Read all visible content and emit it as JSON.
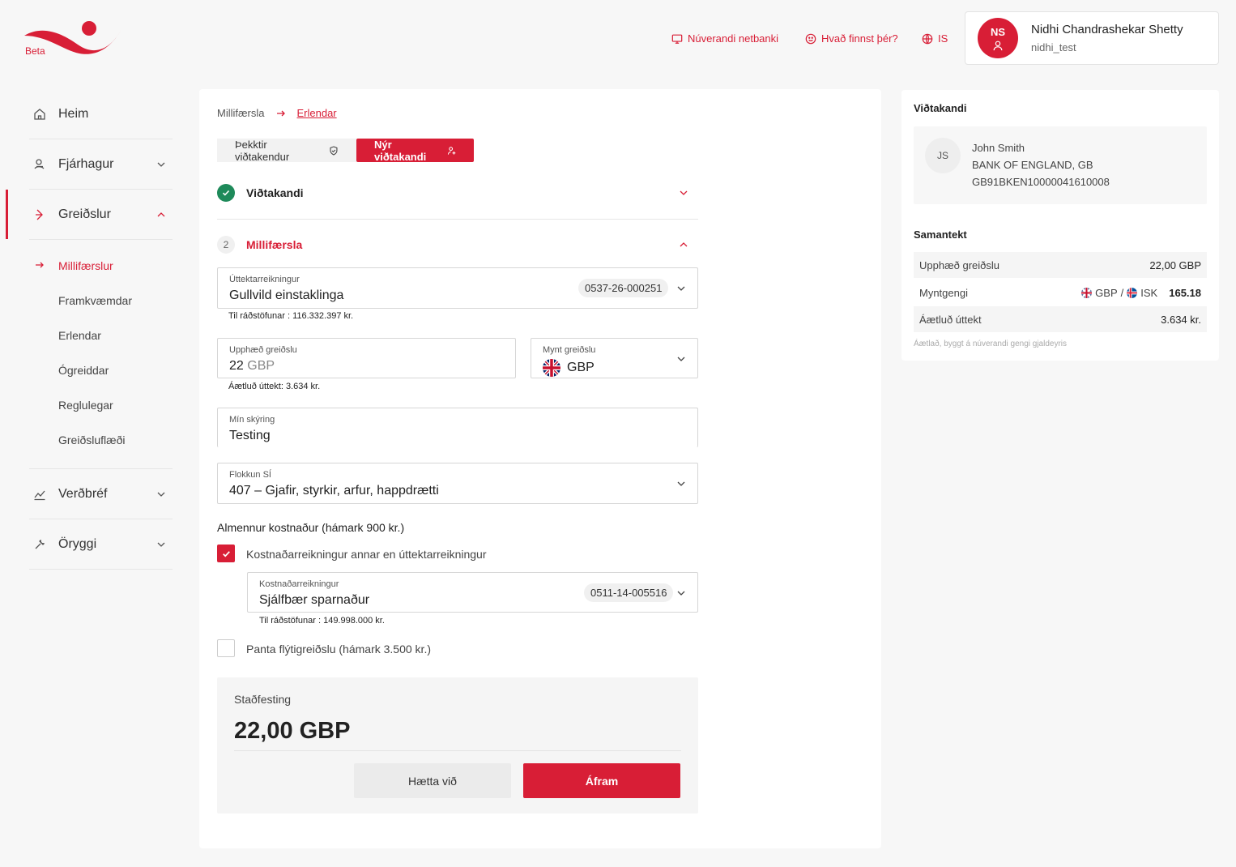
{
  "header": {
    "beta_label": "Beta",
    "links": [
      {
        "label": "Núverandi netbanki",
        "icon": "monitor-icon"
      },
      {
        "label": "Hvað finnst þér?",
        "icon": "smiley-icon"
      },
      {
        "label": "IS",
        "icon": "globe-icon"
      }
    ],
    "user": {
      "initials": "NS",
      "name": "Nidhi Chandrashekar Shetty",
      "handle": "nidhi_test"
    }
  },
  "sidebar": {
    "items": [
      {
        "label": "Heim",
        "icon": "home-icon"
      },
      {
        "label": "Fjárhagur",
        "icon": "money-icon"
      },
      {
        "label": "Greiðslur",
        "icon": "payment-icon"
      },
      {
        "label": "Verðbréf",
        "icon": "chart-icon"
      },
      {
        "label": "Öryggi",
        "icon": "wrench-icon"
      }
    ],
    "sub_items": [
      "Millifærslur",
      "Framkvæmdar",
      "Erlendar",
      "Ógreiddar",
      "Reglulegar",
      "Greiðsluflæði"
    ]
  },
  "main": {
    "breadcrumb": {
      "parent": "Millifærsla",
      "current": "Erlendar"
    },
    "tabs": {
      "known": "Þekktir viðtakendur",
      "new": "Nýr viðtakandi"
    },
    "section1": {
      "title": "Viðtakandi"
    },
    "section2": {
      "step": "2",
      "title": "Millifærsla"
    },
    "withdrawal": {
      "label": "Úttektarreikningur",
      "value": "Gullvild einstaklinga",
      "account": "0537-26-000251",
      "available_label": "Til ráðstöfunar : ",
      "available": "116.332.397 kr."
    },
    "amount": {
      "label": "Upphæð greiðslu",
      "value": "22",
      "currency": "GBP",
      "estimate_label": "Áætluð úttekt: ",
      "estimate": "3.634 kr."
    },
    "currency": {
      "label": "Mynt greiðslu",
      "value": "GBP"
    },
    "description": {
      "label": "Mín skýring",
      "value": "Testing"
    },
    "category": {
      "label": "Flokkun SÍ",
      "value": "407 – Gjafir, styrkir, arfur, happdrætti"
    },
    "cost_title": "Almennur kostnaður (hámark 900 kr.)",
    "cost_checkbox": "Kostnaðarreikningur annar en úttektarreikningur",
    "cost_account": {
      "label": "Kostnaðarreikningur",
      "value": "Sjálfbær sparnaður",
      "account": "0511-14-005516",
      "available_label": "Til ráðstöfunar : ",
      "available": "149.998.000 kr."
    },
    "express_checkbox": "Panta flýtigreiðslu (hámark 3.500 kr.)",
    "confirm": {
      "title": "Staðfesting",
      "amount": "22,00 GBP",
      "cancel": "Hætta við",
      "continue": "Áfram"
    }
  },
  "side": {
    "recipient_title": "Viðtakandi",
    "recipient": {
      "initials": "JS",
      "name": "John Smith",
      "bank": "BANK OF ENGLAND, GB",
      "iban": "GB91BKEN10000041610008"
    },
    "summary_title": "Samantekt",
    "rows": {
      "amount_label": "Upphæð greiðslu",
      "amount_value": "22,00 GBP",
      "rate_label": "Myntgengi",
      "rate_from": "GBP",
      "rate_sep": "/",
      "rate_to": "ISK",
      "rate_value": "165.18",
      "withdraw_label": "Áætluð úttekt",
      "withdraw_value": "3.634 kr."
    },
    "note": "Áætlað, byggt á núverandi gengi gjaldeyris"
  },
  "colors": {
    "accent": "#d81e36",
    "success": "#1e8a5a"
  }
}
